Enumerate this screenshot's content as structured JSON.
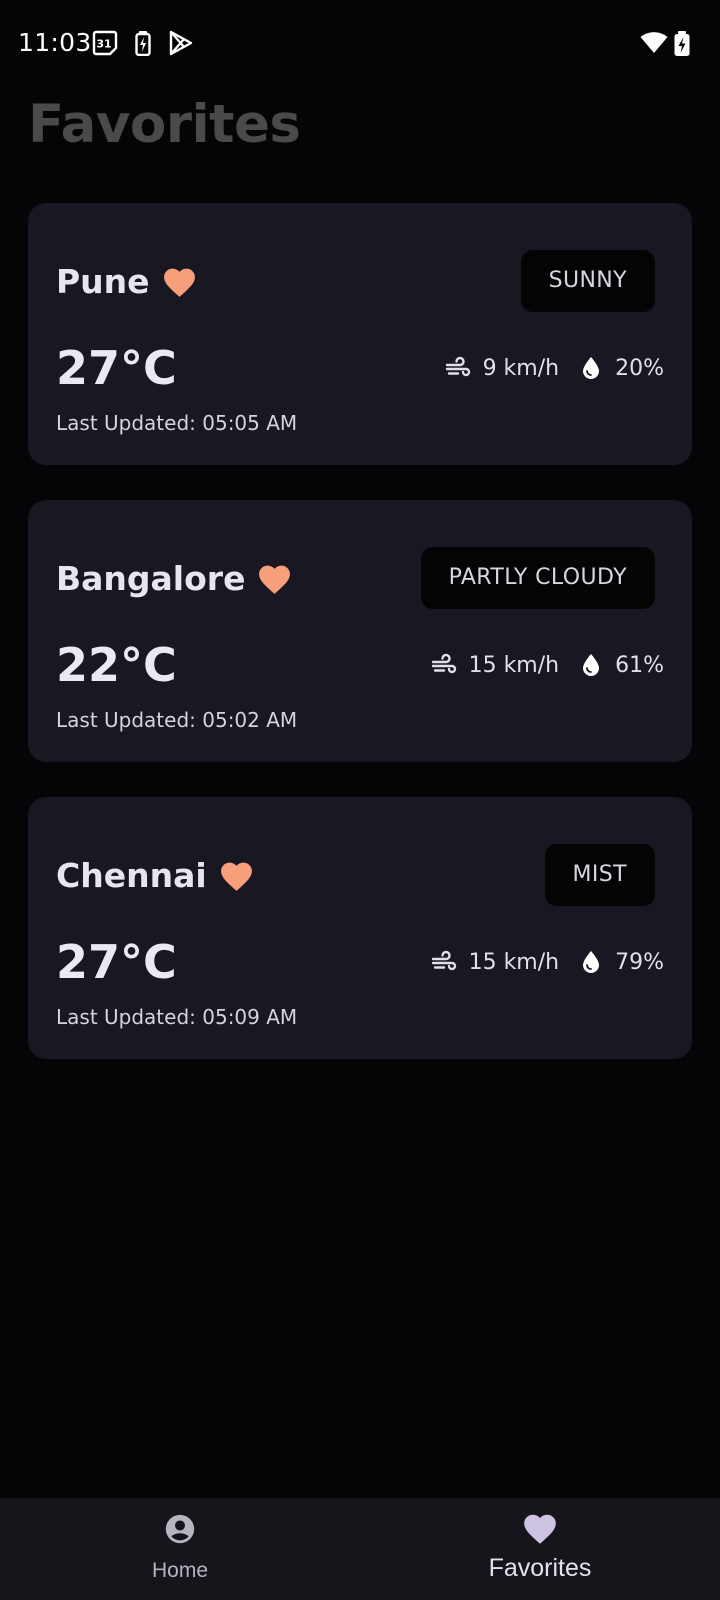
{
  "status_bar": {
    "time": "11:03",
    "icons": [
      "calendar-icon",
      "battery-saver-icon",
      "play-store-icon",
      "wifi-icon",
      "battery-charging-icon"
    ],
    "calendar_day": "31"
  },
  "page": {
    "title": "Favorites"
  },
  "favorites": [
    {
      "city": "Pune",
      "condition": "SUNNY",
      "temperature": "27°C",
      "wind": "9 km/h",
      "humidity": "20%",
      "last_updated": "Last Updated: 05:05 AM"
    },
    {
      "city": "Bangalore",
      "condition": "PARTLY CLOUDY",
      "temperature": "22°C",
      "wind": "15 km/h",
      "humidity": "61%",
      "last_updated": "Last Updated: 05:02 AM"
    },
    {
      "city": "Chennai",
      "condition": "MIST",
      "temperature": "27°C",
      "wind": "15 km/h",
      "humidity": "79%",
      "last_updated": "Last Updated: 05:09 AM"
    }
  ],
  "bottom_nav": {
    "items": [
      {
        "label": "Home",
        "icon": "account-circle-icon",
        "selected": false
      },
      {
        "label": "Favorites",
        "icon": "heart-icon",
        "selected": true
      }
    ]
  },
  "colors": {
    "background": "#050507",
    "card": "#181722",
    "heart": "#f79e7a",
    "title": "#4a4a4c",
    "nav_selected": "#cfc3e3"
  }
}
